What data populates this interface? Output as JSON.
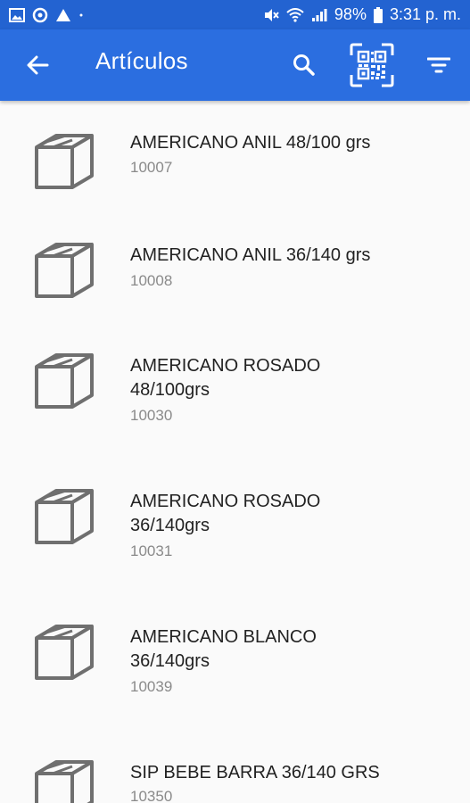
{
  "status_bar": {
    "battery": "98%",
    "time": "3:31 p. m."
  },
  "app_bar": {
    "title": "Artículos"
  },
  "items": [
    {
      "name": "AMERICANO ANIL 48/100 grs",
      "code": "10007"
    },
    {
      "name": "AMERICANO ANIL 36/140 grs",
      "code": "10008"
    },
    {
      "name": "AMERICANO ROSADO 48/100grs",
      "code": "10030"
    },
    {
      "name": "AMERICANO ROSADO 36/140grs",
      "code": "10031"
    },
    {
      "name": "AMERICANO BLANCO 36/140grs",
      "code": "10039"
    },
    {
      "name": "SIP BEBE BARRA 36/140 GRS",
      "code": "10350"
    }
  ],
  "icons": {
    "item": "box-icon",
    "back": "arrow-left-icon",
    "search": "search-icon",
    "qr": "qr-code-scan-icon",
    "filter": "filter-icon"
  },
  "colors": {
    "app_bar": "#2b6ee0",
    "status_bar": "#2363d1",
    "background": "#fafafa"
  }
}
